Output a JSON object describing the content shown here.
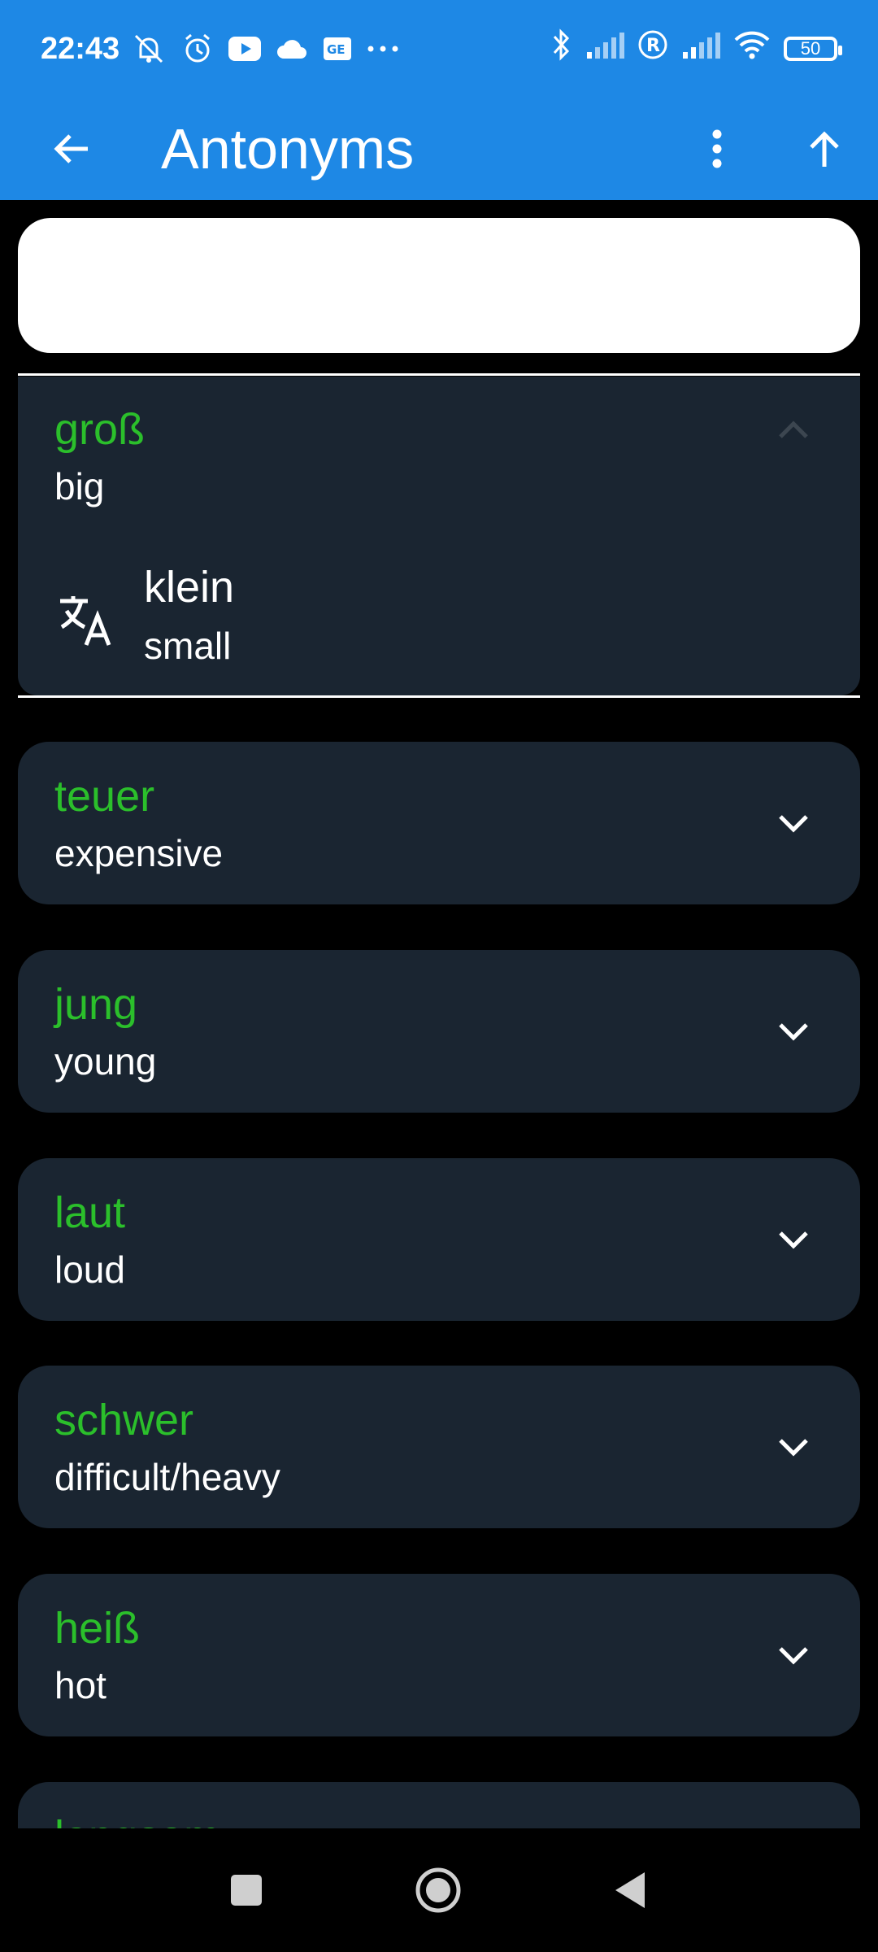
{
  "status_bar": {
    "time": "22:43",
    "battery": "50",
    "left_icons": [
      "muted-bell-icon",
      "alarm-icon",
      "youtube-icon",
      "cloud-icon",
      "news-icon",
      "more-dots-icon"
    ],
    "right_icons": [
      "bluetooth-icon",
      "signal-icon",
      "roaming-icon",
      "signal-icon",
      "wifi-icon"
    ]
  },
  "app_bar": {
    "title": "Antonyms",
    "back_icon": "arrow-left-icon",
    "menu_icon": "more-vert-icon",
    "up_icon": "arrow-up-icon"
  },
  "search": {
    "value": "",
    "placeholder": ""
  },
  "colors": {
    "app_bar": "#1e88e5",
    "background": "#000000",
    "card": "#1a2531",
    "word": "#2bbf2b",
    "text": "#ffffff"
  },
  "items": [
    {
      "word": "groß",
      "meaning": "big",
      "expanded": true,
      "antonym": {
        "word": "klein",
        "meaning": "small",
        "icon": "translate-icon"
      }
    },
    {
      "word": "teuer",
      "meaning": "expensive",
      "expanded": false
    },
    {
      "word": "jung",
      "meaning": "young",
      "expanded": false
    },
    {
      "word": "laut",
      "meaning": "loud",
      "expanded": false
    },
    {
      "word": "schwer",
      "meaning": "difficult/heavy",
      "expanded": false
    },
    {
      "word": "heiß",
      "meaning": "hot",
      "expanded": false
    },
    {
      "word": "langsam",
      "meaning": "",
      "expanded": false
    }
  ],
  "nav_bar": {
    "recents_icon": "square-icon",
    "home_icon": "circle-home-icon",
    "back_icon": "triangle-back-icon"
  }
}
